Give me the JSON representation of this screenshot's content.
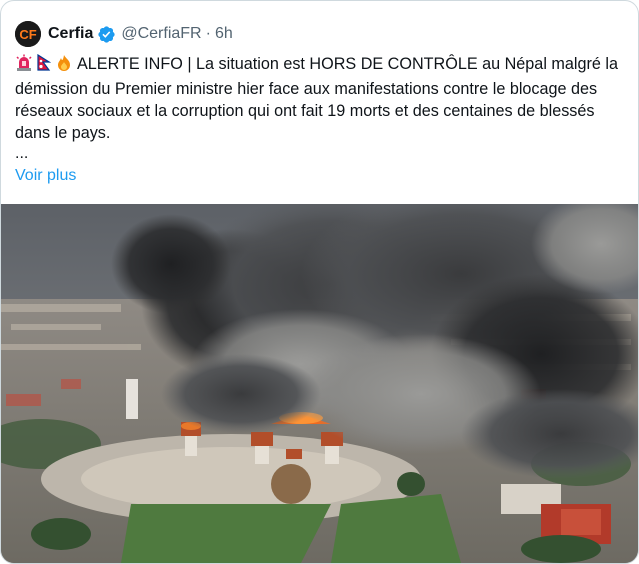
{
  "author": {
    "name": "Cerfia",
    "handle": "@CerfiaFR",
    "separator": "·",
    "time": "6h",
    "avatar_icon": "cerfia-logo-icon",
    "verified_icon": "verified-badge-icon"
  },
  "post": {
    "emoji_icons": [
      "rotating-light-icon",
      "nepal-flag-icon",
      "fire-icon"
    ],
    "text": "ALERTE INFO | La situation est HORS DE CONTRÔLE au Népal malgré la démission du Premier ministre hier face aux manifestations contre le blocage des réseaux sociaux et la corruption qui ont fait 19 morts et des centaines de blessés dans le pays.",
    "ellipsis": "...",
    "see_more": "Voir plus"
  },
  "colors": {
    "link": "#1d9bf0",
    "secondary_text": "#536471",
    "verified": "#1d9bf0",
    "border": "#cfd9de"
  }
}
